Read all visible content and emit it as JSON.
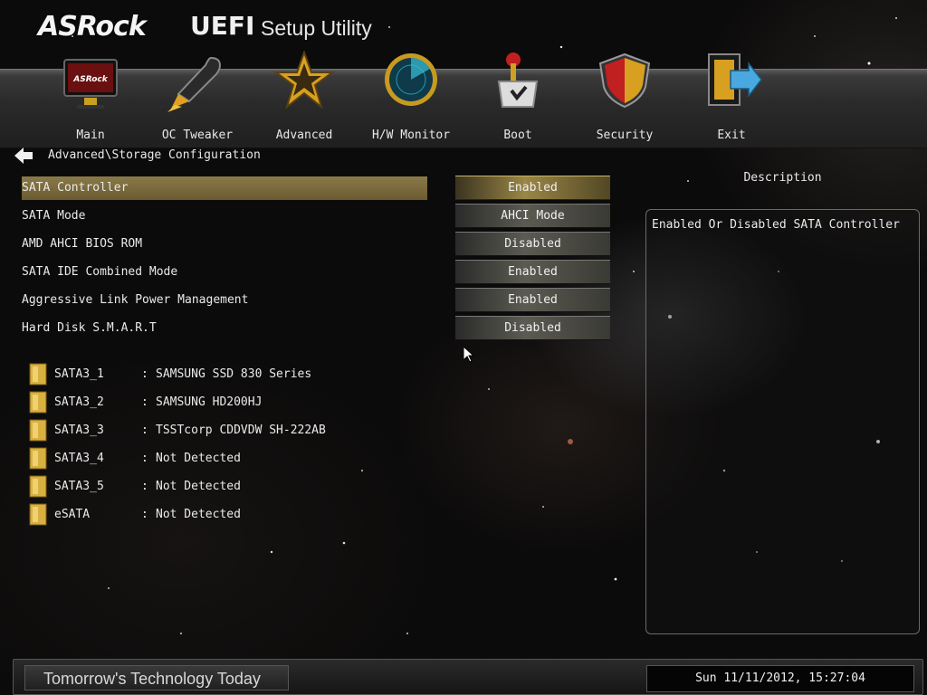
{
  "header": {
    "brand": "ASRock",
    "uefi": "UEFI",
    "setup": "Setup Utility"
  },
  "nav": [
    {
      "label": "Main",
      "icon": "monitor-icon"
    },
    {
      "label": "OC Tweaker",
      "icon": "rocket-icon"
    },
    {
      "label": "Advanced",
      "icon": "star-icon"
    },
    {
      "label": "H/W Monitor",
      "icon": "radar-icon"
    },
    {
      "label": "Boot",
      "icon": "joystick-icon"
    },
    {
      "label": "Security",
      "icon": "shield-icon"
    },
    {
      "label": "Exit",
      "icon": "exit-door-icon"
    }
  ],
  "breadcrumb": "Advanced\\Storage Configuration",
  "settings": [
    {
      "label": "SATA Controller",
      "value": "Enabled",
      "selected": true
    },
    {
      "label": "SATA Mode",
      "value": "AHCI Mode"
    },
    {
      "label": "AMD AHCI BIOS ROM",
      "value": "Disabled"
    },
    {
      "label": "SATA IDE Combined Mode",
      "value": "Enabled"
    },
    {
      "label": "Aggressive Link Power Management",
      "value": "Enabled"
    },
    {
      "label": "Hard Disk S.M.A.R.T",
      "value": "Disabled"
    }
  ],
  "drives": [
    {
      "port": "SATA3_1",
      "sep": ":",
      "model": "SAMSUNG SSD 830 Series"
    },
    {
      "port": "SATA3_2",
      "sep": ":",
      "model": "SAMSUNG HD200HJ"
    },
    {
      "port": "SATA3_3",
      "sep": ":",
      "model": "TSSTcorp CDDVDW SH-222AB"
    },
    {
      "port": "SATA3_4",
      "sep": ":",
      "model": "Not Detected"
    },
    {
      "port": "SATA3_5",
      "sep": ":",
      "model": "Not Detected"
    },
    {
      "port": "eSATA",
      "sep": ":",
      "model": "Not Detected"
    }
  ],
  "description": {
    "title": "Description",
    "text": "Enabled Or Disabled SATA Controller"
  },
  "footer": {
    "tagline": "Tomorrow's Technology Today",
    "datetime": "Sun 11/11/2012, 15:27:04"
  },
  "colors": {
    "selection": "#8a7a4a",
    "background": "#0c0b0b",
    "text": "#e8e8e8"
  }
}
